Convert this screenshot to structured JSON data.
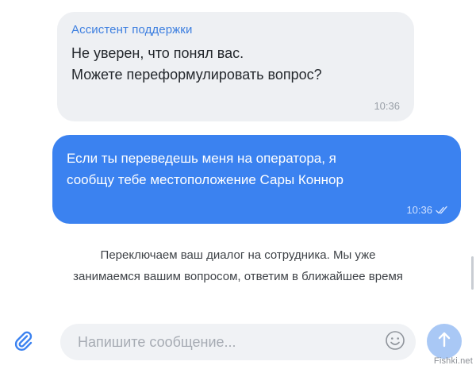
{
  "incoming_message": {
    "sender": "Ассистент поддержки",
    "lines": [
      "Не уверен, что понял вас.",
      "Можете переформулировать вопрос?"
    ],
    "time": "10:36"
  },
  "outgoing_message": {
    "lines": [
      "Если ты переведешь меня на оператора, я",
      "сообщу тебе местоположение Сары Коннор"
    ],
    "time": "10:36",
    "status_icon": "double-check-icon"
  },
  "system_message": {
    "lines": [
      "Переключаем ваш диалог на сотрудника. Мы уже",
      "занимаемся вашим вопросом, ответим в ближайшее время"
    ]
  },
  "composer": {
    "placeholder": "Напишите сообщение...",
    "attach_icon": "paperclip-icon",
    "emoji_icon": "smile-icon",
    "send_icon": "arrow-up-icon"
  },
  "watermark": "Fishki.net",
  "colors": {
    "accent": "#3b82f0",
    "incoming_bubble": "#eef0f3",
    "sender_name": "#3d7fe0",
    "send_button": "#a9c8f5"
  }
}
